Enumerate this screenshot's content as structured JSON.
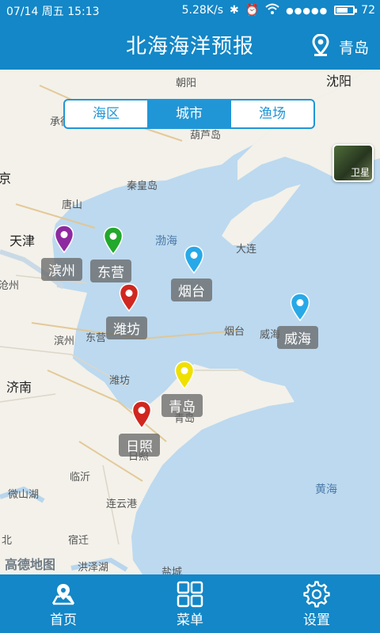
{
  "status": {
    "time_text": "07/14  周五  15:13",
    "net_speed": "5.28K/s",
    "signal_dots": "●●●●●",
    "battery_level": "72",
    "battery_fill": 0.72
  },
  "header": {
    "title": "北海海洋预报",
    "city": "青岛",
    "location_icon": "location-pin-icon"
  },
  "tabs": [
    {
      "label": "海区",
      "active": false
    },
    {
      "label": "城市",
      "active": true
    },
    {
      "label": "渔场",
      "active": false
    }
  ],
  "satellite_label": "卫星",
  "map_labels": [
    "朝阳",
    "沈阳",
    "承德",
    "葫芦岛",
    "京",
    "秦皇岛",
    "唐山",
    "天津",
    "渤海",
    "大连",
    "沧州",
    "滨州",
    "东营",
    "烟台",
    "威海",
    "济南",
    "潍坊",
    "青岛",
    "日照",
    "临沂",
    "微山湖",
    "连云港",
    "黄海",
    "宿迁",
    "洪泽湖",
    "盐城",
    "北"
  ],
  "markers": [
    {
      "name": "滨州",
      "color": "#8e2aa0"
    },
    {
      "name": "东营",
      "color": "#8a5fe0"
    },
    {
      "name": "烟台",
      "color": "#22a82c"
    },
    {
      "name": "潍坊",
      "color": "#999999"
    },
    {
      "name": "威海",
      "color": "#27a9e8"
    },
    {
      "name": "青岛",
      "color": "#f0e000"
    },
    {
      "name": "日照",
      "color": "#d0271f"
    }
  ],
  "map_logo": "高德地图",
  "bottom_nav": [
    {
      "label": "首页",
      "icon": "home-map-icon"
    },
    {
      "label": "菜单",
      "icon": "grid-icon"
    },
    {
      "label": "设置",
      "icon": "gear-icon"
    }
  ]
}
